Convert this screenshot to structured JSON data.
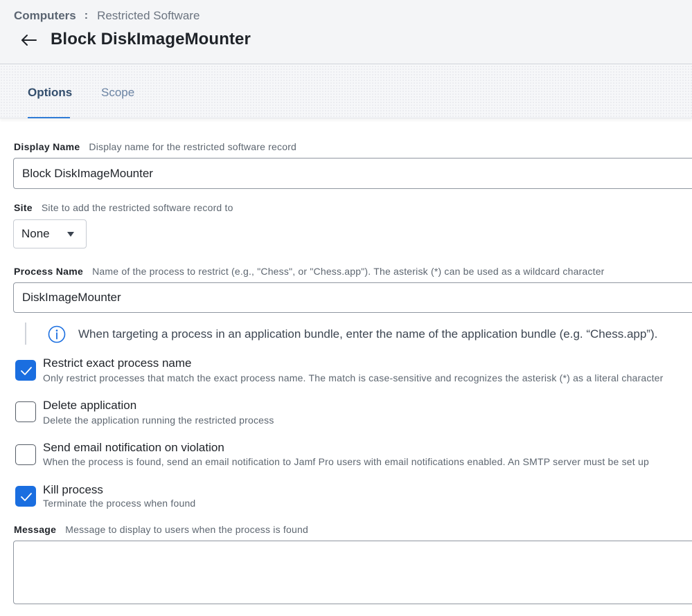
{
  "breadcrumb": {
    "root": "Computers",
    "separator": ":",
    "current": "Restricted Software"
  },
  "page_title": "Block DiskImageMounter",
  "tabs": [
    {
      "label": "Options",
      "active": true
    },
    {
      "label": "Scope",
      "active": false
    }
  ],
  "fields": {
    "display_name": {
      "label": "Display Name",
      "hint": "Display name for the restricted software record",
      "value": "Block DiskImageMounter"
    },
    "site": {
      "label": "Site",
      "hint": "Site to add the restricted software record to",
      "value": "None"
    },
    "process_name": {
      "label": "Process Name",
      "hint": "Name of the process to restrict (e.g., \"Chess\", or \"Chess.app\"). The asterisk (*) can be used as a wildcard character",
      "value": "DiskImageMounter"
    },
    "message": {
      "label": "Message",
      "hint": "Message to display to users when the process is found",
      "value": ""
    }
  },
  "info_note": "When targeting a process in an application bundle, enter the name of the application bundle (e.g. “Chess.app”).",
  "options": [
    {
      "title": "Restrict exact process name",
      "description": "Only restrict processes that match the exact process name. The match is case-sensitive and recognizes the asterisk (*) as a literal character",
      "checked": true
    },
    {
      "title": "Delete application",
      "description": "Delete the application running the restricted process",
      "checked": false
    },
    {
      "title": "Send email notification on violation",
      "description": "When the process is found, send an email notification to Jamf Pro users with email notifications enabled. An SMTP server must be set up",
      "checked": false
    },
    {
      "title": "Kill process",
      "description": "Terminate the process when found",
      "checked": true
    }
  ],
  "colors": {
    "accent": "#1a6ee0",
    "tab_active_underline": "#2e7bd6",
    "header_bg": "#f4f5f7"
  },
  "icons": {
    "back": "arrow-left-icon",
    "info": "info-circle-icon",
    "check": "checkmark-icon",
    "dropdown": "caret-down-icon"
  }
}
